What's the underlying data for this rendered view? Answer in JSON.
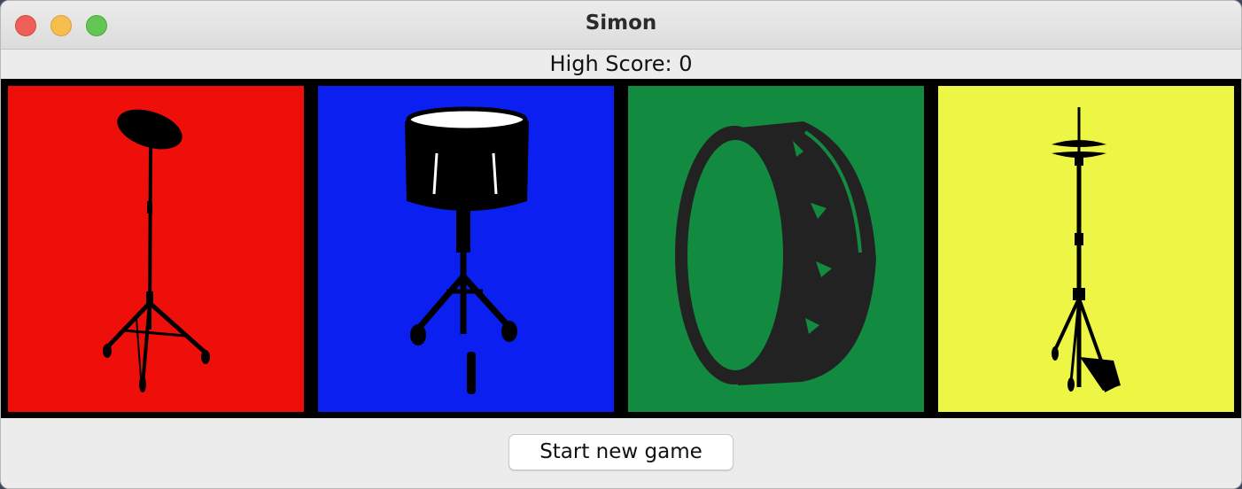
{
  "window": {
    "title": "Simon"
  },
  "header": {
    "high_score_text": "High Score: 0"
  },
  "pads": [
    {
      "color": "#ee0f0a",
      "icon": "cymbal-stand-icon"
    },
    {
      "color": "#0a1ff0",
      "icon": "snare-drum-icon"
    },
    {
      "color": "#128a40",
      "icon": "bass-drum-icon"
    },
    {
      "color": "#eef645",
      "icon": "hi-hat-icon"
    }
  ],
  "footer": {
    "start_button_label": "Start new game"
  }
}
